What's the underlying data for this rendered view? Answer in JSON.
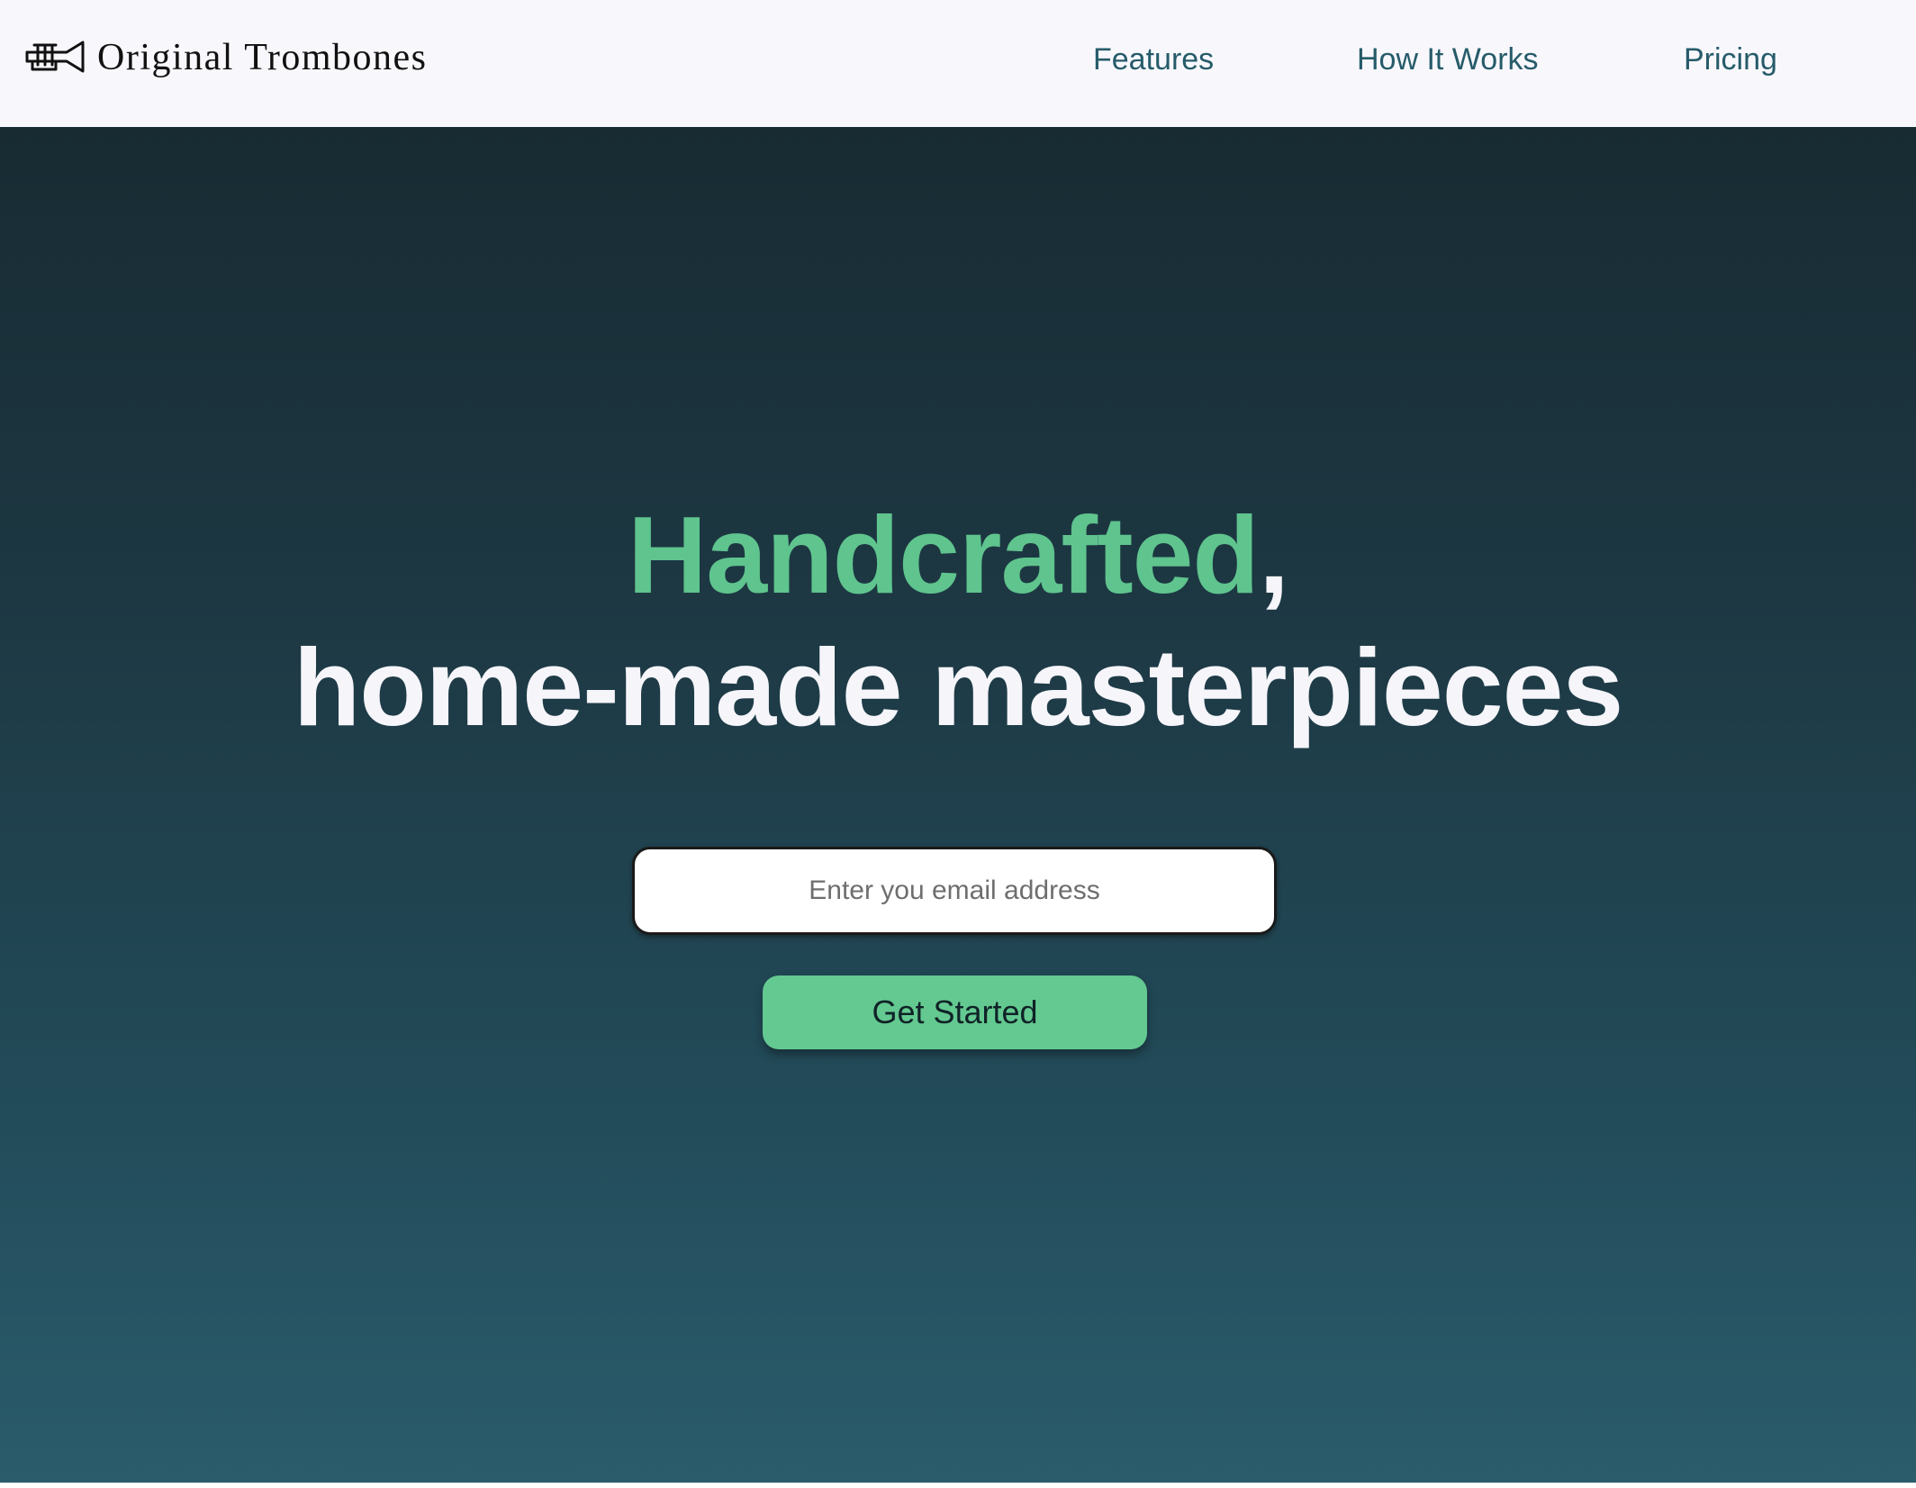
{
  "header": {
    "brand_name": "Original Trombones",
    "logo_icon": "trumpet-icon",
    "nav": [
      {
        "label": "Features"
      },
      {
        "label": "How It Works"
      },
      {
        "label": "Pricing"
      }
    ]
  },
  "hero": {
    "headline_accent": "Handcrafted",
    "headline_comma": ",",
    "headline_line2": "home-made masterpieces",
    "email_placeholder": "Enter you email address",
    "cta_label": "Get Started"
  },
  "colors": {
    "accent": "#5fc48e",
    "nav_text": "#265b6a",
    "hero_top": "#182b33",
    "hero_bottom": "#2a5c6c"
  }
}
